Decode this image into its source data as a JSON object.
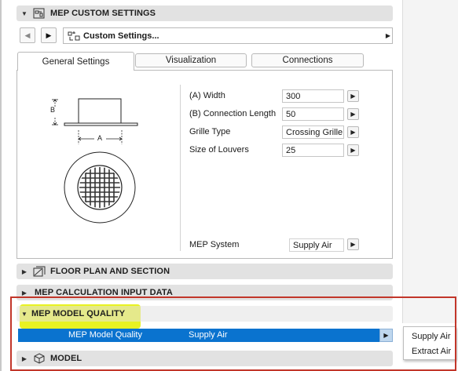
{
  "sections": {
    "custom": {
      "label": "MEP CUSTOM SETTINGS"
    },
    "floor_plan": {
      "label": "FLOOR PLAN AND SECTION"
    },
    "calc": {
      "label": "MEP CALCULATION INPUT DATA"
    },
    "quality": {
      "label": "MEP MODEL QUALITY"
    },
    "model": {
      "label": "MODEL"
    }
  },
  "favorites": {
    "label": "Custom Settings..."
  },
  "tabs": [
    {
      "label": "General Settings",
      "active": true
    },
    {
      "label": "Visualization",
      "active": false
    },
    {
      "label": "Connections",
      "active": false
    }
  ],
  "preview": {
    "dim_a": "A",
    "dim_b": "B"
  },
  "params": [
    {
      "label": "(A) Width",
      "value": "300"
    },
    {
      "label": "(B) Connection Length",
      "value": "50"
    },
    {
      "label": "Grille Type",
      "value": "Crossing Grille"
    },
    {
      "label": "Size of Louvers",
      "value": "25"
    }
  ],
  "mep_system": {
    "label": "MEP System",
    "value": "Supply Air"
  },
  "quality_row": {
    "label": "MEP Model Quality",
    "value": "Supply Air"
  },
  "popup": {
    "options": [
      "Supply Air",
      "Extract Air"
    ]
  },
  "colors": {
    "highlight": "#e8f222",
    "selection": "#0a73cf",
    "annotation_box": "#c2362a"
  }
}
